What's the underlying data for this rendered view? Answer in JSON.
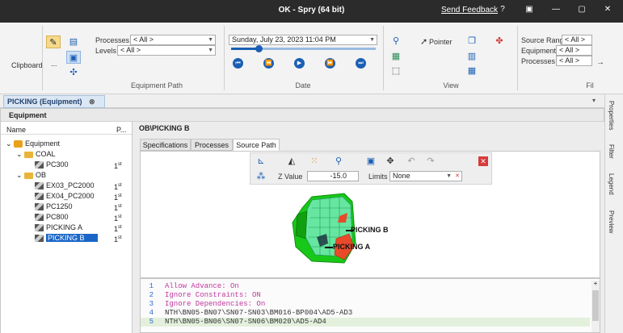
{
  "window": {
    "title": "OK - Spry (64 bit)",
    "feedback": "Send Feedback",
    "controls": [
      "?",
      "▣",
      "—",
      "▢",
      "✕"
    ]
  },
  "ribbon": {
    "clipboard_label": "Clipboard",
    "more_label": "...",
    "processes_label": "Processes",
    "processes_value": "< All >",
    "levels_label": "Levels",
    "levels_value": "< All >",
    "equipment_path_label": "Equipment Path",
    "date_value": "Sunday, July 23, 2023 11:04 PM",
    "date_label": "Date",
    "pointer_label": "Pointer",
    "view_label": "View",
    "source_range_label": "Source Range",
    "source_range_value": "< All >",
    "equipment_label": "Equipment",
    "equipment_value": "< All >",
    "processes2_label": "Processes",
    "processes2_value": "< All >",
    "filter_label": "Fil"
  },
  "doc_tab": {
    "label": "PICKING (Equipment)"
  },
  "equipment_panel": {
    "header": "Equipment",
    "col_name": "Name",
    "col_p": "P...",
    "tree": [
      {
        "label": "Equipment",
        "indent": 0,
        "kind": "root",
        "p": "",
        "expand": "⌄"
      },
      {
        "label": "COAL",
        "indent": 1,
        "kind": "folder",
        "p": "",
        "expand": "⌄"
      },
      {
        "label": "PC300",
        "indent": 2,
        "kind": "machine",
        "p": "1st",
        "expand": ""
      },
      {
        "label": "OB",
        "indent": 1,
        "kind": "folder",
        "p": "",
        "expand": "⌄"
      },
      {
        "label": "EX03_PC2000",
        "indent": 2,
        "kind": "machine",
        "p": "1st",
        "expand": ""
      },
      {
        "label": "EX04_PC2000",
        "indent": 2,
        "kind": "machine",
        "p": "1st",
        "expand": ""
      },
      {
        "label": "PC1250",
        "indent": 2,
        "kind": "machine",
        "p": "1st",
        "expand": ""
      },
      {
        "label": "PC800",
        "indent": 2,
        "kind": "machine",
        "p": "1st",
        "expand": ""
      },
      {
        "label": "PICKING A",
        "indent": 2,
        "kind": "machine",
        "p": "1st",
        "expand": ""
      },
      {
        "label": "PICKING B",
        "indent": 2,
        "kind": "machine",
        "p": "1st",
        "expand": "",
        "selected": true
      }
    ]
  },
  "path_panel": {
    "header": "OB\\PICKING B",
    "tabs": [
      "Specifications",
      "Processes",
      "Source Path"
    ],
    "active_tab": "Source Path",
    "z_label": "Z Value",
    "z_value": "-15.0",
    "limits_label": "Limits",
    "limits_value": "None",
    "label_b": "PICKING B",
    "label_a": "PICKING A"
  },
  "code": {
    "lines": [
      {
        "n": "1",
        "text": "Allow Advance: On",
        "color": "#c0399f"
      },
      {
        "n": "2",
        "text": "Ignore Constraints: ON",
        "color": "#c0399f"
      },
      {
        "n": "3",
        "text": "Ignore Dependencies: On",
        "color": "#c0399f"
      },
      {
        "n": "4",
        "text": "NTH\\BN05-BN07\\SN07-SN03\\BM016-BP004\\AD5-AD3",
        "color": "#333333"
      },
      {
        "n": "5",
        "text": "NTH\\BN05-BN06\\SN07-SN06\\BM020\\AD5-AD4",
        "color": "#333333"
      }
    ]
  },
  "sidebar": {
    "tabs": [
      "Properties",
      "Filter",
      "Legend",
      "Preview"
    ]
  }
}
